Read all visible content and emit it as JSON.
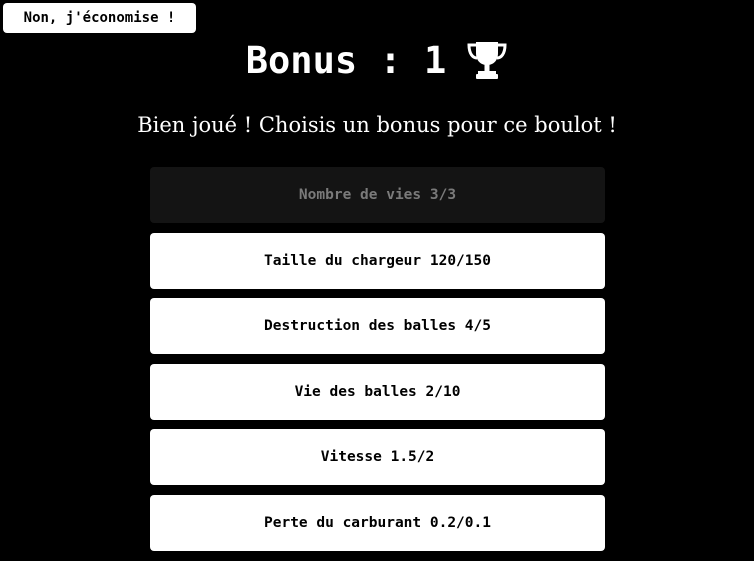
{
  "skip_button": {
    "label": "Non, j'économise !"
  },
  "header": {
    "bonus_label": "Bonus : ",
    "bonus_count": "1",
    "icon": "trophy-icon"
  },
  "subtitle": "Bien joué ! Choisis un bonus pour ce boulot !",
  "colors": {
    "background": "#000000",
    "button_bg": "#ffffff",
    "button_text": "#000000",
    "disabled_bg": "#141414",
    "disabled_text": "#7a7a7a"
  },
  "options": [
    {
      "label": "Nombre de vies 3/3",
      "enabled": false
    },
    {
      "label": "Taille du chargeur 120/150",
      "enabled": true
    },
    {
      "label": "Destruction des balles 4/5",
      "enabled": true
    },
    {
      "label": "Vie des balles 2/10",
      "enabled": true
    },
    {
      "label": "Vitesse 1.5/2",
      "enabled": true
    },
    {
      "label": "Perte du carburant 0.2/0.1",
      "enabled": true
    }
  ]
}
